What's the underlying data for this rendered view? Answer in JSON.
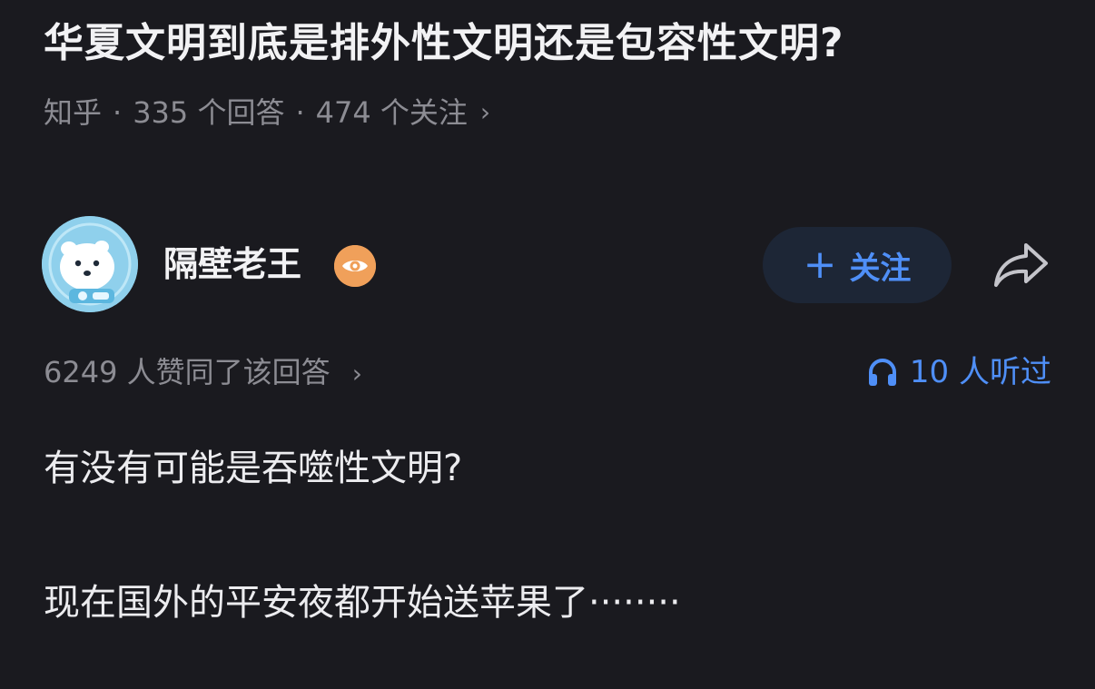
{
  "question": {
    "title": "华夏文明到底是排外性文明还是包容性文明?",
    "source": "知乎",
    "separator": "·",
    "answers_count": "335 个回答",
    "followers_count": "474 个关注",
    "chevron": "›"
  },
  "author": {
    "name": "隔壁老王",
    "avatar_icon": "polar-bear-avatar",
    "badge_icon": "eye-icon",
    "badge_color": "#f0a05a"
  },
  "actions": {
    "follow_plus": "+",
    "follow_label": "关注",
    "share_icon": "share-arrow-icon",
    "accent_color": "#4f8ff7"
  },
  "stats": {
    "upvotes_text": "6249 人赞同了该回答",
    "chevron": "›",
    "listeners_icon": "headphones-icon",
    "listeners_text": "10 人听过"
  },
  "answer": {
    "paragraphs": [
      "有没有可能是吞噬性文明?",
      "现在国外的平安夜都开始送苹果了········"
    ]
  }
}
